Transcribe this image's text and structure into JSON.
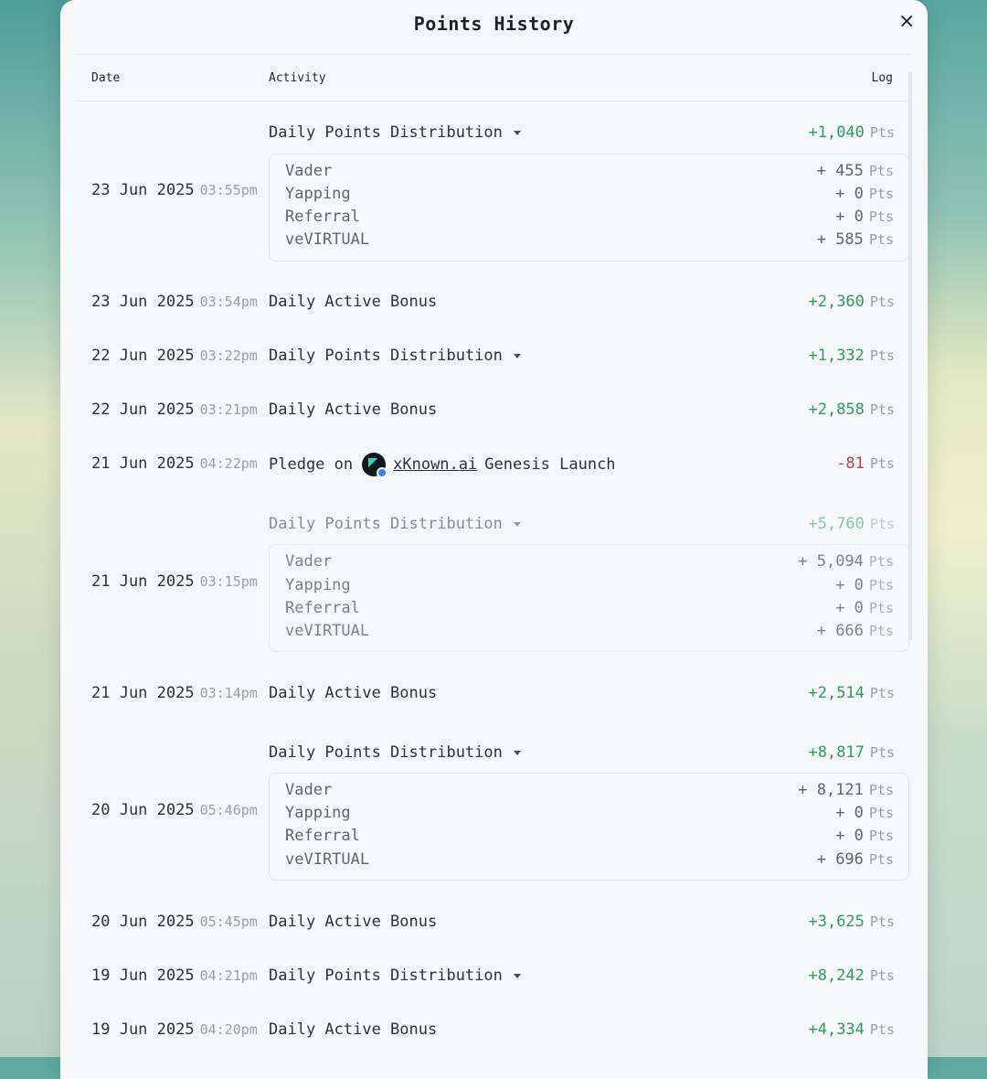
{
  "modal": {
    "title": "Points History",
    "close_label": "×"
  },
  "columns": {
    "date": "Date",
    "activity": "Activity",
    "log": "Log"
  },
  "unit": "Pts",
  "rows": [
    {
      "date": "23 Jun 2025",
      "time": "03:55pm",
      "activity": "Daily Points Distribution",
      "expandable": true,
      "amount": "+1,040",
      "sign": "pos",
      "breakdown": [
        {
          "label": "Vader",
          "amount": "+ 455"
        },
        {
          "label": "Yapping",
          "amount": "+ 0"
        },
        {
          "label": "Referral",
          "amount": "+ 0"
        },
        {
          "label": "veVIRTUAL",
          "amount": "+ 585"
        }
      ]
    },
    {
      "date": "23 Jun 2025",
      "time": "03:54pm",
      "activity": "Daily Active Bonus",
      "amount": "+2,360",
      "sign": "pos"
    },
    {
      "date": "22 Jun 2025",
      "time": "03:22pm",
      "activity": "Daily Points Distribution",
      "expandable": true,
      "amount": "+1,332",
      "sign": "pos"
    },
    {
      "date": "22 Jun 2025",
      "time": "03:21pm",
      "activity": "Daily Active Bonus",
      "amount": "+2,858",
      "sign": "pos"
    },
    {
      "date": "21 Jun 2025",
      "time": "04:22pm",
      "activity_prefix": "Pledge on",
      "activity_link": "xKnown.ai",
      "activity_suffix": "Genesis Launch",
      "amount": "-81",
      "sign": "neg"
    },
    {
      "date": "21 Jun 2025",
      "time": "03:15pm",
      "activity": "Daily Points Distribution",
      "expandable": true,
      "amount": "+5,760",
      "sign": "pos",
      "breakdown": [
        {
          "label": "Vader",
          "amount": "+ 5,094"
        },
        {
          "label": "Yapping",
          "amount": "+ 0"
        },
        {
          "label": "Referral",
          "amount": "+ 0"
        },
        {
          "label": "veVIRTUAL",
          "amount": "+ 666"
        }
      ]
    },
    {
      "date": "21 Jun 2025",
      "time": "03:14pm",
      "activity": "Daily Active Bonus",
      "amount": "+2,514",
      "sign": "pos"
    },
    {
      "date": "20 Jun 2025",
      "time": "05:46pm",
      "activity": "Daily Points Distribution",
      "expandable": true,
      "amount": "+8,817",
      "sign": "pos",
      "breakdown": [
        {
          "label": "Vader",
          "amount": "+ 8,121"
        },
        {
          "label": "Yapping",
          "amount": "+ 0"
        },
        {
          "label": "Referral",
          "amount": "+ 0"
        },
        {
          "label": "veVIRTUAL",
          "amount": "+ 696"
        }
      ]
    },
    {
      "date": "20 Jun 2025",
      "time": "05:45pm",
      "activity": "Daily Active Bonus",
      "amount": "+3,625",
      "sign": "pos"
    },
    {
      "date": "19 Jun 2025",
      "time": "04:21pm",
      "activity": "Daily Points Distribution",
      "expandable": true,
      "amount": "+8,242",
      "sign": "pos"
    },
    {
      "date": "19 Jun 2025",
      "time": "04:20pm",
      "activity": "Daily Active Bonus",
      "amount": "+4,334",
      "sign": "pos"
    }
  ],
  "colors": {
    "positive": "#2f9e5a",
    "negative": "#c43d3d",
    "muted": "#9aa0a8"
  }
}
